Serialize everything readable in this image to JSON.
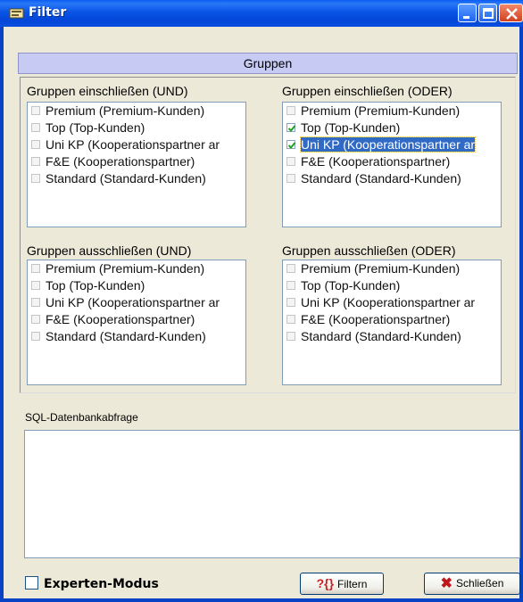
{
  "window": {
    "title": "Filter"
  },
  "gruppen": {
    "header": "Gruppen",
    "include_and": {
      "label": "Gruppen einschließen (UND)",
      "items": [
        {
          "label": "Premium (Premium-Kunden)",
          "checked": false
        },
        {
          "label": "Top (Top-Kunden)",
          "checked": false
        },
        {
          "label": "Uni KP (Kooperationspartner ar",
          "checked": false
        },
        {
          "label": "F&E (Kooperationspartner)",
          "checked": false
        },
        {
          "label": "Standard (Standard-Kunden)",
          "checked": false
        }
      ]
    },
    "include_or": {
      "label": "Gruppen einschließen (ODER)",
      "items": [
        {
          "label": "Premium (Premium-Kunden)",
          "checked": false
        },
        {
          "label": "Top (Top-Kunden)",
          "checked": true
        },
        {
          "label": "Uni KP (Kooperationspartner ar",
          "checked": true,
          "selected": true
        },
        {
          "label": "F&E (Kooperationspartner)",
          "checked": false
        },
        {
          "label": "Standard (Standard-Kunden)",
          "checked": false
        }
      ]
    },
    "exclude_and": {
      "label": "Gruppen ausschließen (UND)",
      "items": [
        {
          "label": "Premium (Premium-Kunden)",
          "checked": false
        },
        {
          "label": "Top (Top-Kunden)",
          "checked": false
        },
        {
          "label": "Uni KP (Kooperationspartner ar",
          "checked": false
        },
        {
          "label": "F&E (Kooperationspartner)",
          "checked": false
        },
        {
          "label": "Standard (Standard-Kunden)",
          "checked": false
        }
      ]
    },
    "exclude_or": {
      "label": "Gruppen ausschließen (ODER)",
      "items": [
        {
          "label": "Premium (Premium-Kunden)",
          "checked": false
        },
        {
          "label": "Top (Top-Kunden)",
          "checked": false
        },
        {
          "label": "Uni KP (Kooperationspartner ar",
          "checked": false
        },
        {
          "label": "F&E (Kooperationspartner)",
          "checked": false
        },
        {
          "label": "Standard (Standard-Kunden)",
          "checked": false
        }
      ]
    }
  },
  "sql": {
    "label": "SQL-Datenbankabfrage",
    "value": ""
  },
  "footer": {
    "expert_label": "Experten-Modus",
    "expert_checked": false,
    "filter_label": "Filtern",
    "close_label": "Schließen"
  },
  "icons": {
    "window": "filter-window-icon",
    "filter_button": "filter-query-icon",
    "close_button": "red-x-icon"
  },
  "colors": {
    "titlebar": "#0a55e6",
    "header_band": "#c7caf3",
    "selection": "#316ac5"
  }
}
